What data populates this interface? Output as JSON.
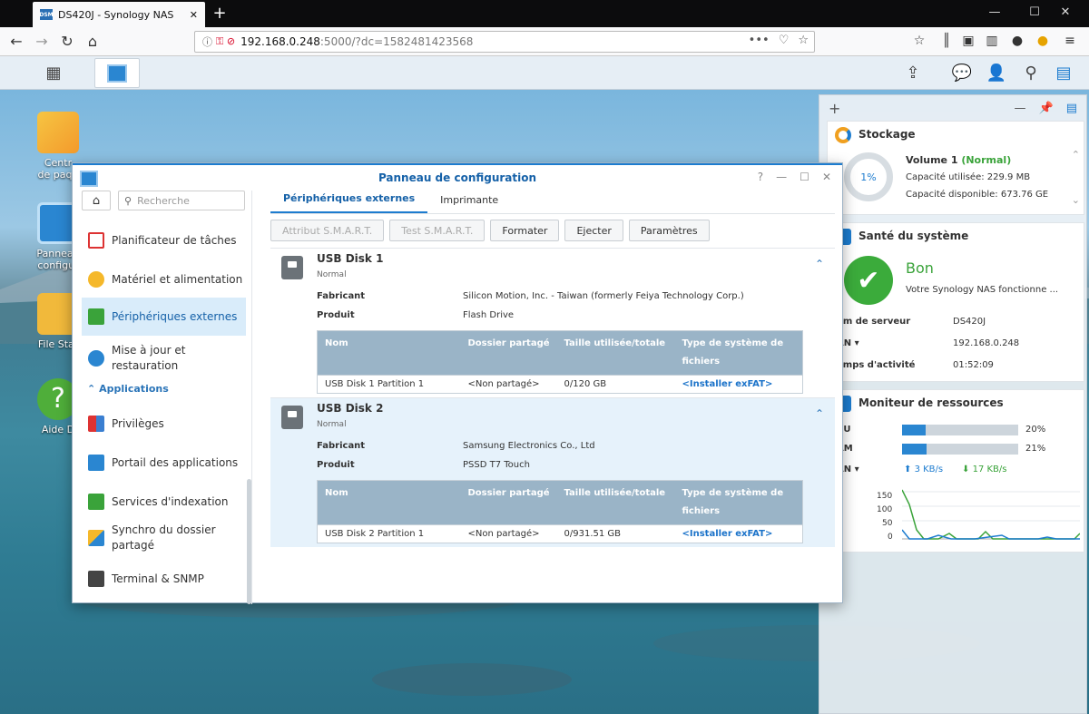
{
  "browser": {
    "tab_title": "DS420J - Synology NAS",
    "url_host": "192.168.0.248",
    "url_path": ":5000/?dc=1582481423568"
  },
  "desktop": {
    "icons": [
      {
        "label": "Centr\nde paqu"
      },
      {
        "label": "Panneau\nconfigur"
      },
      {
        "label": "File Stat"
      },
      {
        "label": "Aide D"
      }
    ]
  },
  "widgets": {
    "storage": {
      "title": "Stockage",
      "percent": "1%",
      "volume_label": "Volume 1",
      "volume_status": "(Normal)",
      "used": "Capacité utilisée: 229.9 MB",
      "available": "Capacité disponible: 673.76 GE"
    },
    "health": {
      "title": "Santé du système",
      "status": "Bon",
      "message": "Votre Synology NAS fonctionne ...",
      "rows": [
        {
          "label": "om de serveur",
          "value": "DS420J"
        },
        {
          "label": "AN ▾",
          "value": "192.168.0.248"
        },
        {
          "label": "emps d'activité",
          "value": "01:52:09"
        }
      ]
    },
    "monitor": {
      "title": "Moniteur de ressources",
      "cpu_label": "PU",
      "cpu_value": "20%",
      "cpu_fraction": 0.2,
      "ram_label": "AM",
      "ram_value": "21%",
      "ram_fraction": 0.21,
      "lan_label": "AN ▾",
      "upload": "3 KB/s",
      "download": "17 KB/s",
      "yticks": [
        "150",
        "100",
        "50",
        "0"
      ]
    }
  },
  "cp": {
    "title": "Panneau de configuration",
    "search_placeholder": "Recherche",
    "sidebar": {
      "items": [
        {
          "label": "Planificateur de tâches"
        },
        {
          "label": "Matériel et alimentation"
        },
        {
          "label": "Périphériques externes"
        },
        {
          "label": "Mise à jour et\nrestauration"
        },
        {
          "label": "Privilèges"
        },
        {
          "label": "Portail des applications"
        },
        {
          "label": "Services d'indexation"
        },
        {
          "label": "Synchro du dossier\npartagé"
        },
        {
          "label": "Terminal & SNMP"
        }
      ],
      "section": "Applications"
    },
    "tabs": [
      "Périphériques externes",
      "Imprimante"
    ],
    "toolbar": [
      "Attribut S.M.A.R.T.",
      "Test S.M.A.R.T.",
      "Formater",
      "Ejecter",
      "Paramètres"
    ],
    "labels": {
      "maker": "Fabricant",
      "product": "Produit",
      "col_name": "Nom",
      "col_share": "Dossier partagé",
      "col_size": "Taille utilisée/totale",
      "col_fs": "Type de système de fichiers"
    },
    "disks": [
      {
        "name": "USB Disk 1",
        "status": "Normal",
        "maker": "Silicon Motion, Inc. - Taiwan (formerly Feiya Technology Corp.)",
        "product": "Flash Drive",
        "partition": "USB Disk 1 Partition 1",
        "share": "<Non partagé>",
        "size": "0/120 GB",
        "fs": "<Installer exFAT>"
      },
      {
        "name": "USB Disk 2",
        "status": "Normal",
        "maker": "Samsung Electronics Co., Ltd",
        "product": "PSSD T7 Touch",
        "partition": "USB Disk 2 Partition 1",
        "share": "<Non partagé>",
        "size": "0/931.51 GB",
        "fs": "<Installer exFAT>"
      }
    ]
  }
}
